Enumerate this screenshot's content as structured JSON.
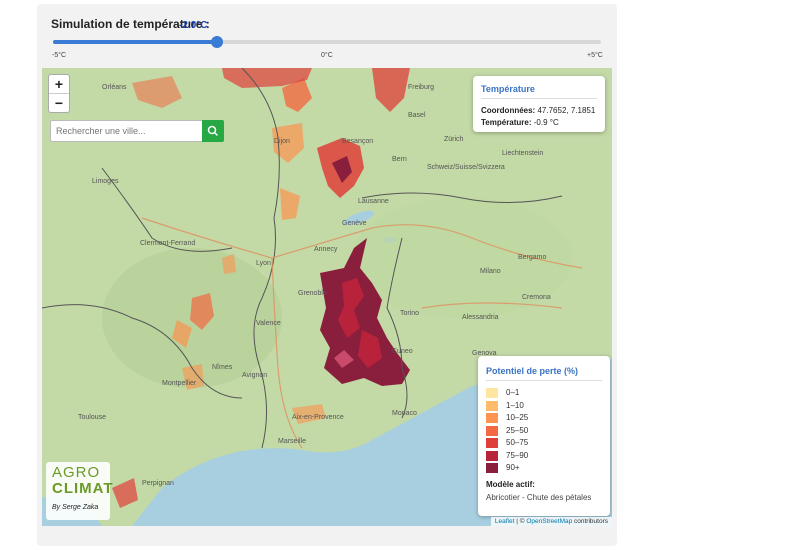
{
  "simulation": {
    "label": "Simulation de température :",
    "value": "-2.0°C",
    "fraction": 0.3,
    "ticks": {
      "min": "-5°C",
      "mid": "0°C",
      "max": "+5°C"
    }
  },
  "map": {
    "zoom_in": "+",
    "zoom_out": "−",
    "search_placeholder": "Rechercher une ville...",
    "places": [
      {
        "name": "Orléans"
      },
      {
        "name": "Dijon"
      },
      {
        "name": "Besançon"
      },
      {
        "name": "Zürich"
      },
      {
        "name": "Bern"
      },
      {
        "name": "Lyon"
      },
      {
        "name": "Genève"
      },
      {
        "name": "Milano"
      },
      {
        "name": "Torino"
      },
      {
        "name": "Grenoble"
      },
      {
        "name": "Valence"
      },
      {
        "name": "Toulouse"
      },
      {
        "name": "Marseille"
      },
      {
        "name": "Monaco"
      },
      {
        "name": "Schweiz/Suisse/Svizzera"
      },
      {
        "name": "Liechtenstein"
      },
      {
        "name": "Clermont-Ferrand"
      },
      {
        "name": "Genova"
      },
      {
        "name": "Bergamo"
      },
      {
        "name": "Cremona"
      },
      {
        "name": "Montpellier"
      },
      {
        "name": "Nîmes"
      },
      {
        "name": "Avignon"
      },
      {
        "name": "Aix-en-Provence"
      },
      {
        "name": "Limoges"
      },
      {
        "name": "Freiburg"
      },
      {
        "name": "Basel"
      },
      {
        "name": "Lausanne"
      },
      {
        "name": "Annecy"
      },
      {
        "name": "Alessandria"
      },
      {
        "name": "Cuneo"
      },
      {
        "name": "Perpignan"
      }
    ]
  },
  "info_popup": {
    "title": "Température",
    "coord_label": "Coordonnées:",
    "coord_value": "47.7652, 7.1851",
    "temp_label": "Température:",
    "temp_value": "-0.9 °C"
  },
  "legend": {
    "title": "Potentiel de perte (%)",
    "items": [
      {
        "label": "0–1",
        "color": "#fee5a0"
      },
      {
        "label": "1–10",
        "color": "#fdbb6b"
      },
      {
        "label": "10–25",
        "color": "#fc9350"
      },
      {
        "label": "25–50",
        "color": "#f26a43"
      },
      {
        "label": "50–75",
        "color": "#df3f3a"
      },
      {
        "label": "75–90",
        "color": "#b9223b"
      },
      {
        "label": "90+",
        "color": "#8a1e3d"
      }
    ],
    "model_title": "Modèle actif:",
    "model_name": "Abricotier - Chute des pétales"
  },
  "logo": {
    "line1": "AGRO",
    "line2": "CLIMAT",
    "author": "By Serge Zaka"
  },
  "attribution": {
    "leaflet": "Leaflet",
    "sep": " | © ",
    "osm": "OpenStreetMap",
    "contrib": " contributors"
  },
  "colors": {
    "accent": "#3a7bd5",
    "search_button": "#28a745",
    "panel_title": "#3a73c4",
    "land": "#c3d9a6",
    "sea": "#a7cfe0"
  }
}
